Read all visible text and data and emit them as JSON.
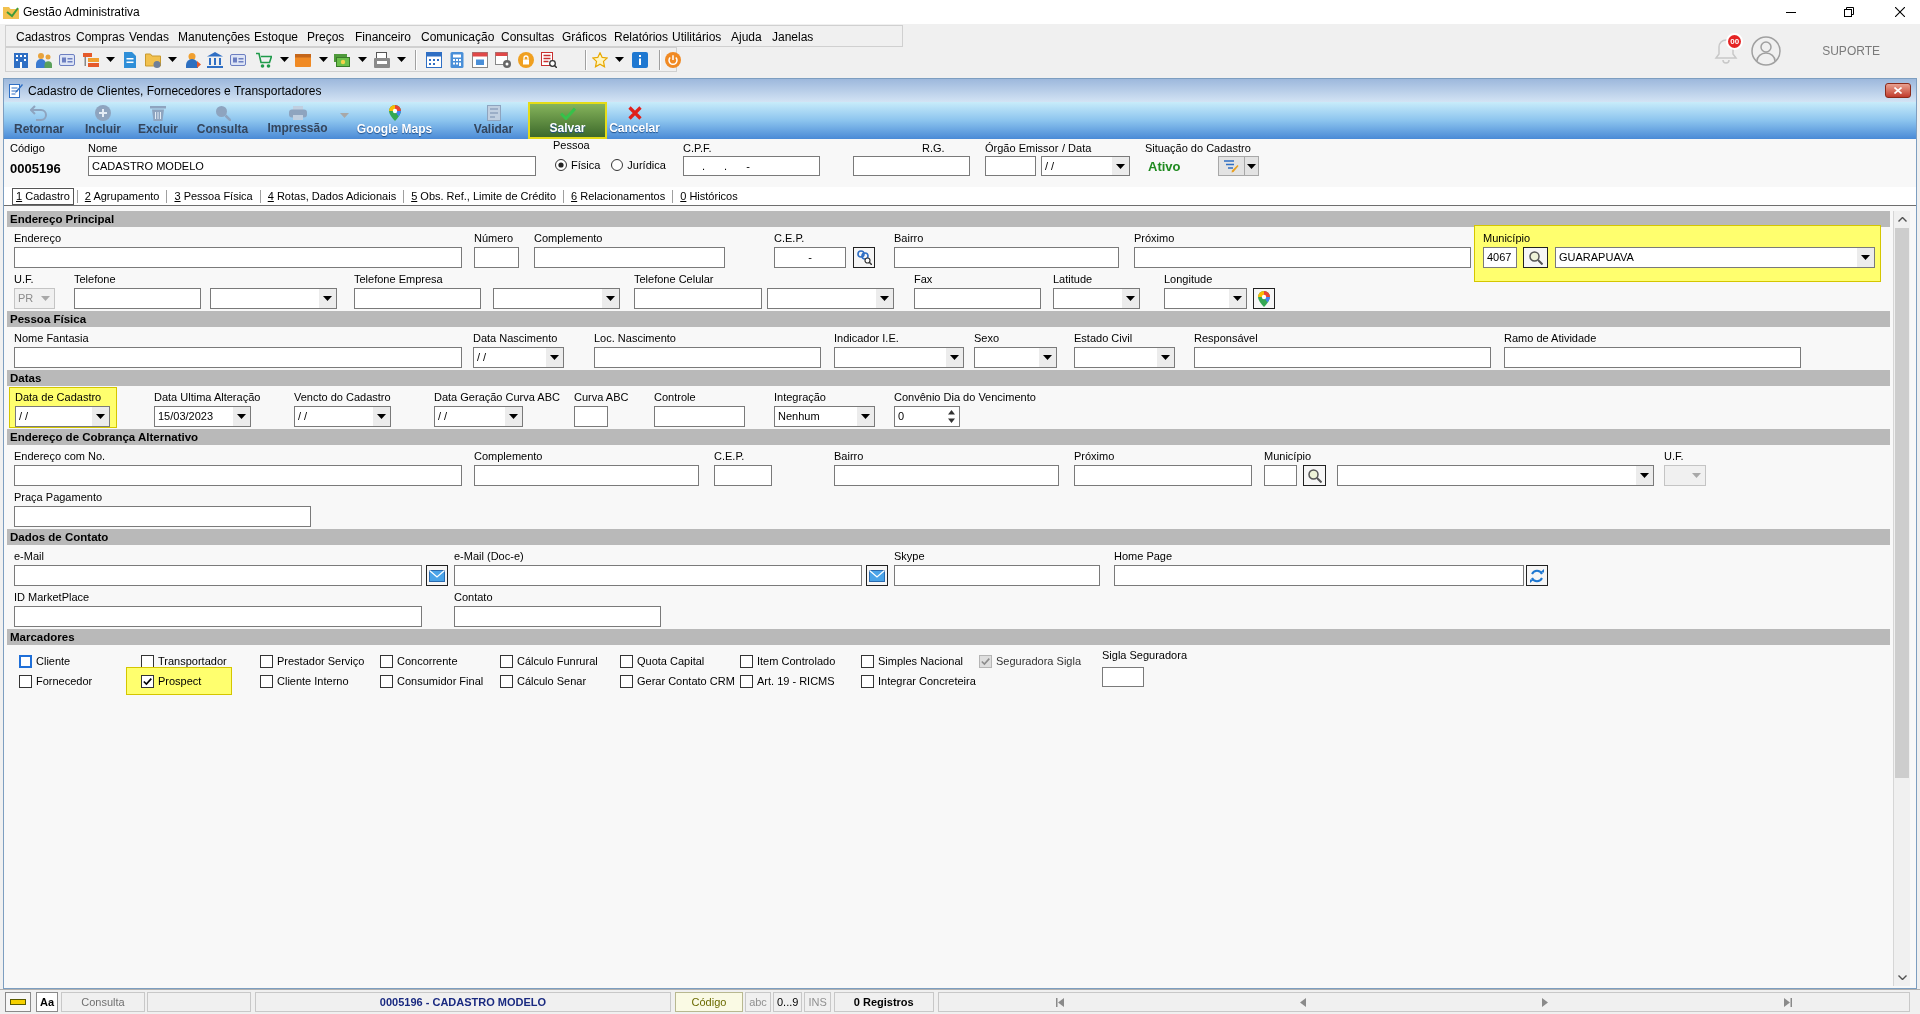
{
  "window": {
    "title": "Gestão Administrativa"
  },
  "menu": [
    "Cadastros",
    "Compras",
    "Vendas",
    "Manutenções",
    "Estoque",
    "Preços",
    "Financeiro",
    "Comunicação",
    "Consultas",
    "Gráficos",
    "Relatórios",
    "Utilitários",
    "Ajuda",
    "Janelas"
  ],
  "user_area": {
    "notifications": "00",
    "user": "SUPORTE"
  },
  "form_window": {
    "title": "Cadastro de Clientes, Fornecedores e Transportadores",
    "actions": [
      {
        "label": "Retornar",
        "disabled": true,
        "highlighted": false,
        "dropdown": false
      },
      {
        "label": "Incluir",
        "disabled": true,
        "highlighted": false,
        "dropdown": false
      },
      {
        "label": "Excluir",
        "disabled": true,
        "highlighted": false,
        "dropdown": false
      },
      {
        "label": "Consulta",
        "disabled": true,
        "highlighted": false,
        "dropdown": false
      },
      {
        "label": "Impressão",
        "disabled": true,
        "highlighted": false,
        "dropdown": true
      },
      {
        "label": "Google Maps",
        "disabled": false,
        "highlighted": false,
        "dropdown": false
      },
      {
        "label": "Validar",
        "disabled": true,
        "highlighted": false,
        "dropdown": false
      },
      {
        "label": "Salvar",
        "disabled": false,
        "highlighted": true,
        "dropdown": false
      },
      {
        "label": "Cancelar",
        "disabled": false,
        "highlighted": false,
        "dropdown": false
      }
    ],
    "header": {
      "code": {
        "label": "Código",
        "value": "0005196"
      },
      "name": {
        "label": "Nome",
        "value": "CADASTRO MODELO"
      },
      "person_type": {
        "label": "Pessoa",
        "options": [
          {
            "label": "Física",
            "selected": true
          },
          {
            "label": "Jurídica",
            "selected": false
          }
        ]
      },
      "cpf": {
        "label": "C.P.F.",
        "value": ". . -"
      },
      "rg": {
        "label": "R.G."
      },
      "issuer": {
        "label": "Órgão Emissor"
      },
      "issue_date": {
        "label": "/ Data",
        "value": "/ /"
      },
      "status": {
        "label": "Situação do Cadastro",
        "value": "Ativo"
      }
    },
    "tabs": [
      {
        "label": "1 Cadastro",
        "selected": true
      },
      {
        "label": "2 Agrupamento",
        "selected": false
      },
      {
        "label": "3 Pessoa Física",
        "selected": false
      },
      {
        "label": "4 Rotas, Dados Adicionais",
        "selected": false
      },
      {
        "label": "5 Obs. Ref., Limite de Crédito",
        "selected": false
      },
      {
        "label": "6 Relacionamentos",
        "selected": false
      },
      {
        "label": "0 Históricos",
        "selected": false
      }
    ],
    "sections": [
      {
        "title": "Endereço Principal",
        "rows": [
          [
            {
              "kind": "text",
              "label": "Endereço",
              "disabled": false,
              "highlighted": false
            },
            {
              "kind": "text",
              "label": "Número",
              "disabled": false,
              "highlighted": false
            },
            {
              "kind": "text",
              "label": "Complemento",
              "disabled": false,
              "highlighted": false
            },
            {
              "kind": "textbutton",
              "label": "C.E.P.",
              "value": "-",
              "disabled": false,
              "highlighted": false
            },
            {
              "kind": "text",
              "label": "Bairro",
              "disabled": false,
              "highlighted": false
            },
            {
              "kind": "text",
              "label": "Próximo",
              "disabled": false,
              "highlighted": false
            },
            {
              "kind": "lookup",
              "label": "Município",
              "code": "4067",
              "value": "GUARAPUAVA",
              "disabled": false,
              "highlighted": true
            }
          ],
          [
            {
              "kind": "combo",
              "label": "U.F.",
              "value": "PR",
              "disabled": true,
              "highlighted": false
            },
            {
              "kind": "text",
              "label": "Telefone",
              "disabled": false,
              "highlighted": false
            },
            {
              "kind": "combo",
              "disabled": false,
              "highlighted": false
            },
            {
              "kind": "text",
              "label": "Telefone Empresa",
              "disabled": false,
              "highlighted": false
            },
            {
              "kind": "combo",
              "disabled": false,
              "highlighted": false
            },
            {
              "kind": "text",
              "label": "Telefone Celular",
              "disabled": false,
              "highlighted": false
            },
            {
              "kind": "combo",
              "disabled": false,
              "highlighted": false
            },
            {
              "kind": "text",
              "label": "Fax",
              "disabled": false,
              "highlighted": false
            },
            {
              "kind": "combo",
              "label": "Latitude",
              "disabled": false,
              "highlighted": false
            },
            {
              "kind": "combobutton",
              "label": "Longitude",
              "disabled": false,
              "highlighted": false
            }
          ]
        ]
      },
      {
        "title": "Pessoa Física",
        "rows": [
          [
            {
              "kind": "text",
              "label": "Nome Fantasia",
              "disabled": false,
              "highlighted": false
            },
            {
              "kind": "combo",
              "label": "Data Nascimento",
              "value": "/ /",
              "disabled": false,
              "highlighted": false
            },
            {
              "kind": "text",
              "label": "Loc. Nascimento",
              "disabled": false,
              "highlighted": false
            },
            {
              "kind": "combo",
              "label": "Indicador I.E.",
              "disabled": false,
              "highlighted": false
            },
            {
              "kind": "combo",
              "label": "Sexo",
              "disabled": false,
              "highlighted": false
            },
            {
              "kind": "combo",
              "label": "Estado Civil",
              "disabled": false,
              "highlighted": false
            },
            {
              "kind": "text",
              "label": "Responsável",
              "disabled": false,
              "highlighted": false
            },
            {
              "kind": "text",
              "label": "Ramo de Atividade",
              "disabled": false,
              "highlighted": false
            }
          ]
        ]
      },
      {
        "title": "Datas",
        "rows": [
          [
            {
              "kind": "combo",
              "label": "Data de Cadastro",
              "value": "/ /",
              "disabled": false,
              "highlighted": true
            },
            {
              "kind": "combo",
              "label": "Data Ultima Alteração",
              "value": "15/03/2023",
              "disabled": false,
              "highlighted": false
            },
            {
              "kind": "combo",
              "label": "Vencto do Cadastro",
              "value": "/ /",
              "disabled": false,
              "highlighted": false
            },
            {
              "kind": "combo",
              "label": "Data Geração Curva ABC",
              "value": "/ /",
              "disabled": false,
              "highlighted": false
            },
            {
              "kind": "text",
              "label": "Curva ABC",
              "disabled": false,
              "highlighted": false
            },
            {
              "kind": "text",
              "label": "Controle",
              "disabled": false,
              "highlighted": false
            },
            {
              "kind": "combo",
              "label": "Integração",
              "value": "Nenhum",
              "disabled": false,
              "highlighted": false
            },
            {
              "kind": "spin",
              "label": "Convênio Dia do Vencimento",
              "value": "0",
              "disabled": false,
              "highlighted": false
            }
          ]
        ]
      },
      {
        "title": "Endereço de Cobrança Alternativo",
        "rows": [
          [
            {
              "kind": "text",
              "label": "Endereço com No.",
              "disabled": false,
              "highlighted": false
            },
            {
              "kind": "text",
              "label": "Complemento",
              "disabled": false,
              "highlighted": false
            },
            {
              "kind": "text",
              "label": "C.E.P.",
              "disabled": false,
              "highlighted": false
            },
            {
              "kind": "text",
              "label": "Bairro",
              "disabled": false,
              "highlighted": false
            },
            {
              "kind": "text",
              "label": "Próximo",
              "disabled": false,
              "highlighted": false
            },
            {
              "kind": "lookup",
              "label": "Município",
              "disabled": false,
              "highlighted": false
            },
            {
              "kind": "combo",
              "label": "U.F.",
              "disabled": true,
              "highlighted": false
            }
          ],
          [
            {
              "kind": "text",
              "label": "Praça Pagamento",
              "disabled": false,
              "highlighted": false
            }
          ]
        ]
      },
      {
        "title": "Dados de Contato",
        "rows": [
          [
            {
              "kind": "textbutton",
              "label": "e-Mail",
              "disabled": false,
              "highlighted": false
            },
            {
              "kind": "textbutton",
              "label": "e-Mail (Doc-e)",
              "disabled": false,
              "highlighted": false
            },
            {
              "kind": "text",
              "label": "Skype",
              "disabled": false,
              "highlighted": false
            },
            {
              "kind": "textbutton",
              "label": "Home Page",
              "disabled": false,
              "highlighted": false
            }
          ],
          [
            {
              "kind": "text",
              "label": "ID MarketPlace",
              "disabled": false,
              "highlighted": false
            },
            {
              "kind": "text",
              "label": "Contato",
              "disabled": false,
              "highlighted": false
            }
          ]
        ]
      }
    ],
    "markers": {
      "title": "Marcadores",
      "rows": [
        [
          {
            "label": "Cliente",
            "checked": false,
            "disabled": false,
            "focused": true,
            "highlighted": false
          },
          {
            "label": "Transportador",
            "checked": false,
            "disabled": false,
            "focused": false,
            "highlighted": false
          },
          {
            "label": "Prestador Serviço",
            "checked": false,
            "disabled": false,
            "focused": false,
            "highlighted": false
          },
          {
            "label": "Concorrente",
            "checked": false,
            "disabled": false,
            "focused": false,
            "highlighted": false
          },
          {
            "label": "Cálculo Funrural",
            "checked": false,
            "disabled": false,
            "focused": false,
            "highlighted": false
          },
          {
            "label": "Quota Capital",
            "checked": false,
            "disabled": false,
            "focused": false,
            "highlighted": false
          },
          {
            "label": "Item Controlado",
            "checked": false,
            "disabled": false,
            "focused": false,
            "highlighted": false
          },
          {
            "label": "Simples Nacional",
            "checked": false,
            "disabled": false,
            "focused": false,
            "highlighted": false
          },
          {
            "label": "Seguradora Sigla",
            "checked": true,
            "disabled": true,
            "focused": false,
            "highlighted": false
          }
        ],
        [
          {
            "label": "Fornecedor",
            "checked": false,
            "disabled": false,
            "focused": false,
            "highlighted": false
          },
          {
            "label": "Prospect",
            "checked": true,
            "disabled": false,
            "focused": false,
            "highlighted": true
          },
          {
            "label": "Cliente Interno",
            "checked": false,
            "disabled": false,
            "focused": false,
            "highlighted": false
          },
          {
            "label": "Consumidor Final",
            "checked": false,
            "disabled": false,
            "focused": false,
            "highlighted": false
          },
          {
            "label": "Cálculo Senar",
            "checked": false,
            "disabled": false,
            "focused": false,
            "highlighted": false
          },
          {
            "label": "Gerar Contato CRM",
            "checked": false,
            "disabled": false,
            "focused": false,
            "highlighted": false
          },
          {
            "label": "Art. 19 - RICMS",
            "checked": false,
            "disabled": false,
            "focused": false,
            "highlighted": false
          },
          {
            "label": "Integrar Concreteira",
            "checked": false,
            "disabled": false,
            "focused": false,
            "highlighted": false
          }
        ]
      ],
      "sigla": {
        "label": "Sigla Seguradora"
      }
    }
  },
  "status_bar": {
    "font_button": "Aa",
    "mode": "Consulta",
    "record": "0005196 - CADASTRO MODELO",
    "search_field": "Código",
    "indicators": [
      {
        "label": "abc",
        "on": false
      },
      {
        "label": "0...9",
        "on": true
      },
      {
        "label": "INS",
        "on": false
      }
    ],
    "count": "0 Registros"
  }
}
